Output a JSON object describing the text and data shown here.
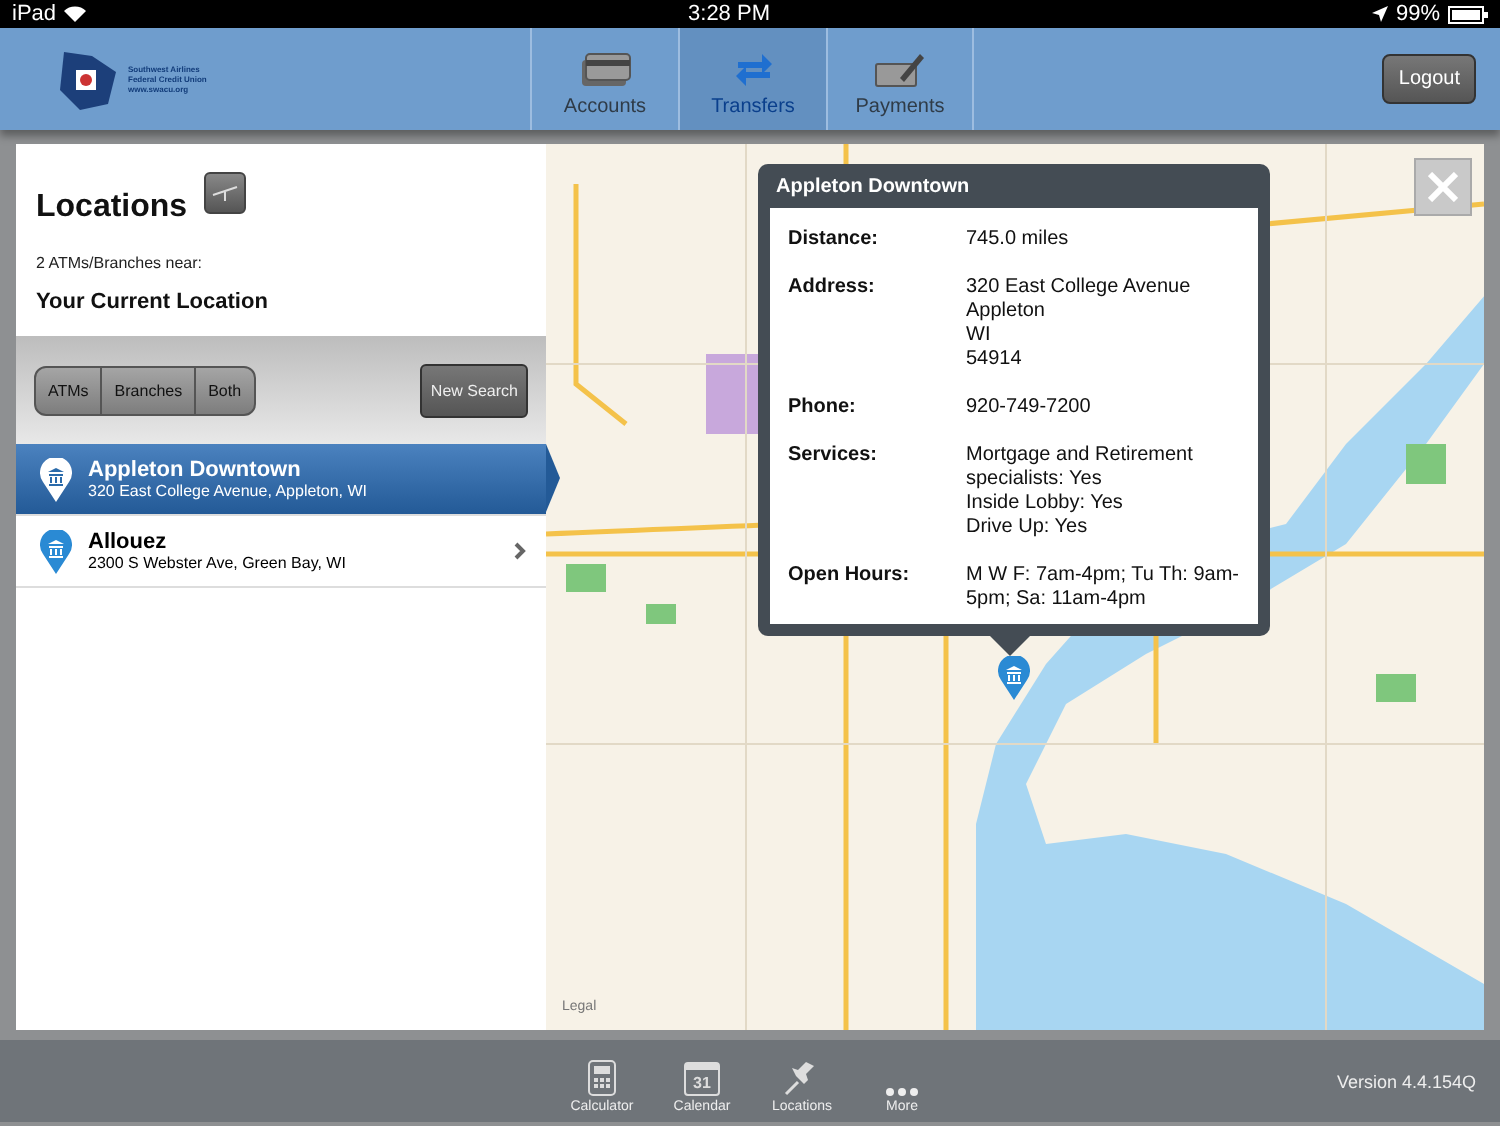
{
  "status_bar": {
    "carrier": "iPad",
    "time": "3:28 PM",
    "battery": "99%"
  },
  "header": {
    "logo_lines": [
      "Southwest Airlines",
      "Federal Credit Union",
      "www.swacu.org"
    ],
    "tabs": [
      {
        "label": "Accounts",
        "kind": "card",
        "selected": false
      },
      {
        "label": "Transfers",
        "kind": "arrows",
        "selected": true
      },
      {
        "label": "Payments",
        "kind": "check",
        "selected": false
      }
    ],
    "logout": "Logout"
  },
  "locations": {
    "title": "Locations",
    "count_text": "2 ATMs/Branches near:",
    "near": "Your Current Location",
    "filters": [
      {
        "label": "ATMs",
        "selected": false
      },
      {
        "label": "Branches",
        "selected": false
      },
      {
        "label": "Both",
        "selected": false
      }
    ],
    "new_search": "New Search",
    "items": [
      {
        "name": "Appleton  Downtown",
        "address": "320 East College Avenue, Appleton, WI",
        "selected": true
      },
      {
        "name": "Allouez",
        "address": "2300 S Webster Ave, Green Bay, WI",
        "selected": false
      }
    ]
  },
  "map": {
    "legal": "Legal",
    "popup": {
      "title": "Appleton  Downtown",
      "fields": [
        {
          "label": "Distance:",
          "lines": [
            "745.0 miles"
          ]
        },
        {
          "label": "Address:",
          "lines": [
            "320 East College Avenue",
            "Appleton",
            "WI",
            "54914"
          ]
        },
        {
          "label": "Phone:",
          "lines": [
            "920-749-7200"
          ]
        },
        {
          "label": "Services:",
          "lines": [
            "Mortgage and Retirement specialists: Yes",
            "Inside Lobby: Yes",
            "Drive Up: Yes"
          ]
        },
        {
          "label": "Open Hours:",
          "lines": [
            "M W F: 7am-4pm; Tu Th: 9am-5pm; Sa: 11am-4pm"
          ]
        }
      ]
    }
  },
  "bottom_bar": {
    "items": [
      {
        "label": "Calculator",
        "kind": "calculator"
      },
      {
        "label": "Calendar",
        "kind": "calendar",
        "icon_text": "31"
      },
      {
        "label": "Locations",
        "kind": "pin"
      },
      {
        "label": "More",
        "kind": "more"
      }
    ],
    "version": "Version 4.4.154Q"
  }
}
